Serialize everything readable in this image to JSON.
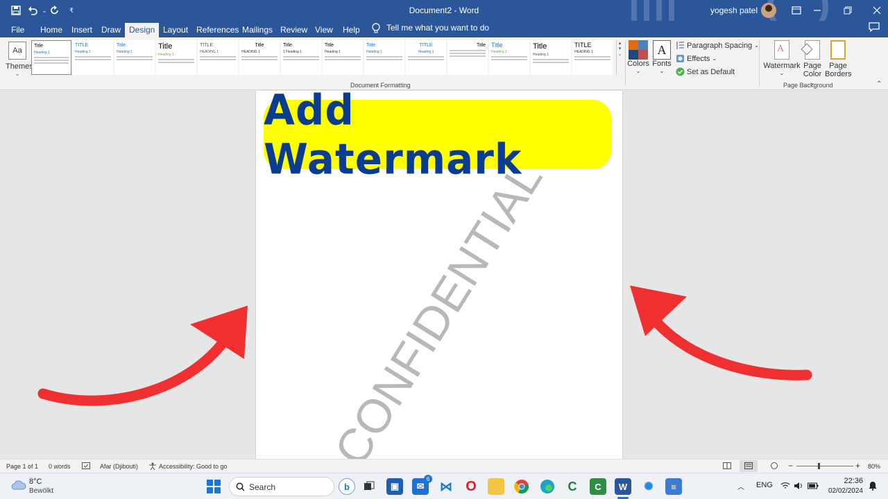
{
  "titlebar": {
    "doc_title": "Document2  -  Word",
    "user_name": "yogesh patel",
    "quick_access": [
      "save-icon",
      "undo-icon",
      "redo-icon",
      "customize-icon"
    ]
  },
  "tabs": [
    {
      "label": "File"
    },
    {
      "label": "Home"
    },
    {
      "label": "Insert"
    },
    {
      "label": "Draw"
    },
    {
      "label": "Design",
      "active": true
    },
    {
      "label": "Layout"
    },
    {
      "label": "References"
    },
    {
      "label": "Mailings"
    },
    {
      "label": "Review"
    },
    {
      "label": "View"
    },
    {
      "label": "Help"
    }
  ],
  "tellme": "Tell me what you want to do",
  "ribbon": {
    "themes_label": "Themes",
    "themes_icon_text": "Aa",
    "style_sets": [
      {
        "title": "Title",
        "heading": "Heading 1"
      },
      {
        "title": "TITLE",
        "heading": "Heading 1"
      },
      {
        "title": "Title",
        "heading": "Heading 1"
      },
      {
        "title": "Title",
        "heading": ""
      },
      {
        "title": "TITLE",
        "heading": "HEADING 1"
      },
      {
        "title": "Title",
        "heading": "HEADING 1"
      },
      {
        "title": "Title",
        "heading": "1  Heading 1"
      },
      {
        "title": "Title",
        "heading": "Heading 1"
      },
      {
        "title": "Title",
        "heading": "Heading 1"
      },
      {
        "title": "TITLE",
        "heading": "Heading 1"
      },
      {
        "title": "Title",
        "heading": ""
      },
      {
        "title": "Title",
        "heading": "Heading 1"
      },
      {
        "title": "Title",
        "heading": "Heading 1"
      },
      {
        "title": "TITLE",
        "heading": "HEADING 1"
      }
    ],
    "group_document_formatting": "Document Formatting",
    "colors_label": "Colors",
    "fonts_label": "Fonts",
    "fonts_icon_text": "A",
    "paragraph_spacing": "Paragraph Spacing",
    "effects": "Effects",
    "set_as_default": "Set as Default",
    "watermark_label": "Watermark",
    "page_color_line1": "Page",
    "page_color_line2": "Color",
    "page_borders_line1": "Page",
    "page_borders_line2": "Borders",
    "group_page_background": "Page Background",
    "colors_swatch": [
      "#e36c0a",
      "#4f81bd",
      "#1f497d",
      "#c0504d"
    ]
  },
  "document": {
    "banner_text": "Add Watermark",
    "banner_bg": "#ffff00",
    "banner_color": "#0a3d91",
    "watermark_text": "CONFIDENTIAL",
    "arrow_color": "#f03030"
  },
  "statusbar": {
    "page": "Page 1 of 1",
    "words": "0 words",
    "language": "Afar (Djibouti)",
    "accessibility": "Accessibility: Good to go",
    "zoom": "80%"
  },
  "taskbar": {
    "weather_temp": "8°C",
    "weather_desc": "Bewölkt",
    "search_placeholder": "Search",
    "mail_badge": "6",
    "lang": "ENG",
    "time": "22:36",
    "date": "02/02/2024"
  }
}
